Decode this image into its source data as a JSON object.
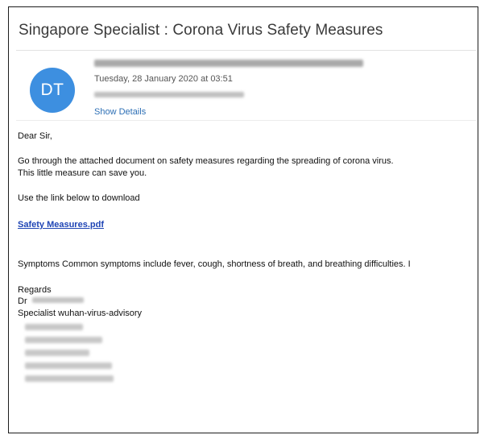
{
  "email": {
    "subject": "Singapore Specialist  : Corona Virus Safety Measures",
    "avatar_initials": "DT",
    "avatar_color": "#3d8fe0",
    "date": "Tuesday, 28 January 2020 at 03:51",
    "show_details_label": "Show Details",
    "link_color": "#1f45b5"
  },
  "body": {
    "greeting": "Dear Sir,",
    "paragraph_line1": "Go through the attached document on safety measures regarding the spreading of corona virus.",
    "paragraph_line2": "This little measure can save you.",
    "instruction": "Use the link below to download",
    "attachment_link": "Safety Measures.pdf",
    "symptoms": "Symptoms  Common symptoms include fever, cough, shortness of breath, and breathing difficulties. I",
    "closing": "Regards",
    "dr_prefix": "Dr",
    "signature_title": "Specialist wuhan-virus-advisory"
  }
}
